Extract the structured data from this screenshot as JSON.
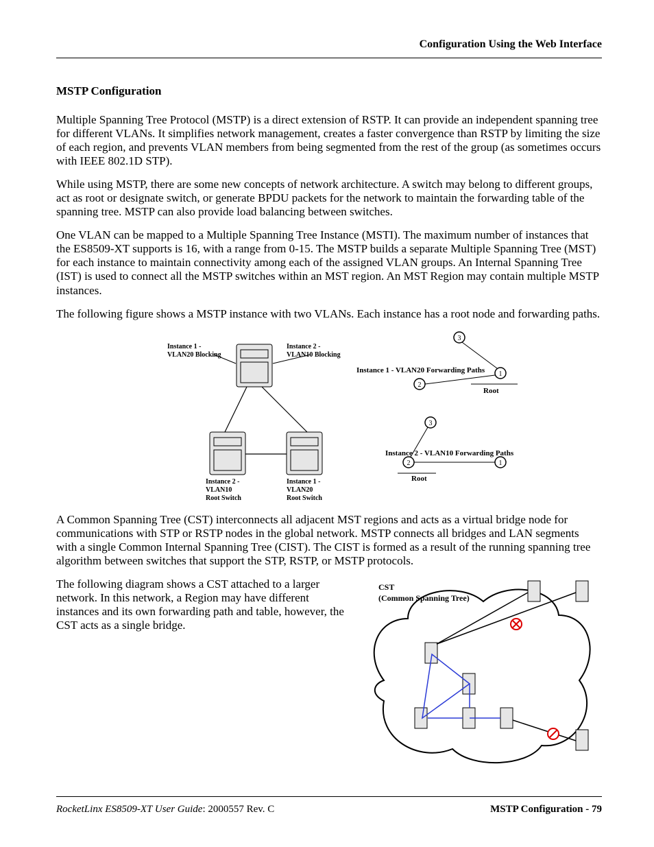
{
  "header": {
    "running": "Configuration Using the Web Interface"
  },
  "section": {
    "heading": "MSTP Configuration"
  },
  "paras": {
    "p1": "Multiple Spanning Tree Protocol (MSTP) is a direct extension of RSTP. It can provide an independent spanning tree for different VLANs. It simplifies network management, creates a faster convergence than RSTP by limiting the size of each region, and prevents VLAN members from being segmented from the rest of the group (as sometimes occurs with IEEE 802.1D STP).",
    "p2": "While using MSTP, there are some new concepts of network architecture. A switch may belong to different groups, act as root or designate switch, or generate BPDU packets for the network to maintain the forwarding table of the spanning tree. MSTP can also provide load balancing between switches.",
    "p3": "One VLAN can be mapped to a Multiple Spanning Tree Instance (MSTI). The maximum number of instances that the ES8509-XT supports is 16, with a range from 0-15. The MSTP builds a separate Multiple Spanning Tree (MST) for each instance to maintain connectivity among each of the assigned VLAN groups. An Internal Spanning Tree (IST) is used to connect all the MSTP switches within an MST region. An MST Region may contain multiple MSTP instances.",
    "p4": "The following figure shows a MSTP instance with two VLANs. Each instance has a root node and forwarding paths.",
    "p5": "A Common Spanning Tree (CST) interconnects all adjacent MST regions and acts as a virtual bridge node for communications with STP or RSTP nodes in the global network. MSTP connects all bridges and LAN segments with a single Common Internal Spanning Tree (CIST). The CIST is formed as a result of the running spanning tree algorithm between switches that support the STP, RSTP, or MSTP protocols.",
    "p6": "The following diagram shows a CST attached to a larger network. In this network, a Region may have different instances and its own forwarding path and table, however, the CST acts as a single bridge."
  },
  "fig1": {
    "l_inst1_block": "Instance 1 -\nVLAN20 Blocking",
    "l_inst2_block": "Instance 2 -\nVLAN10 Blocking",
    "l_inst2_root": "Instance 2 -\nVLAN10\nRoot Switch",
    "l_inst1_root": "Instance 1 -\nVLAN20\nRoot Switch",
    "cap1": "Instance 1 - VLAN20 Forwarding Paths",
    "cap2": "Instance 2 - VLAN10 Forwarding Paths",
    "root": "Root"
  },
  "fig2": {
    "title": "CST",
    "sub": "(Common Spanning Tree)"
  },
  "footer": {
    "left_italic": "RocketLinx ES8509-XT User Guide",
    "left_rest": ": 2000557 Rev. C",
    "right": "MSTP Configuration - 79"
  }
}
